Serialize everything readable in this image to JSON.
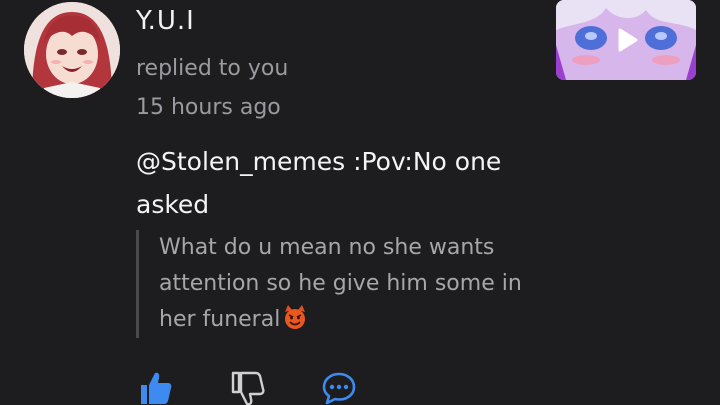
{
  "comment": {
    "username": "Y.U.I",
    "action": "replied to you",
    "timestamp": "15 hours ago",
    "text": "@Stolen_memes :Pov:No one asked",
    "quoted_text": "What do u mean no she wants attention so he give him some in her funeral",
    "quoted_emoji": "smiling-devil-emoji"
  },
  "media": {
    "thumbnail_icon": "play-icon"
  },
  "actions": {
    "like_icon": "thumbs-up-icon",
    "dislike_icon": "thumbs-down-icon",
    "reply_icon": "comment-bubble-icon"
  },
  "colors": {
    "background": "#1d1d1f",
    "accent": "#3d8bf0"
  }
}
